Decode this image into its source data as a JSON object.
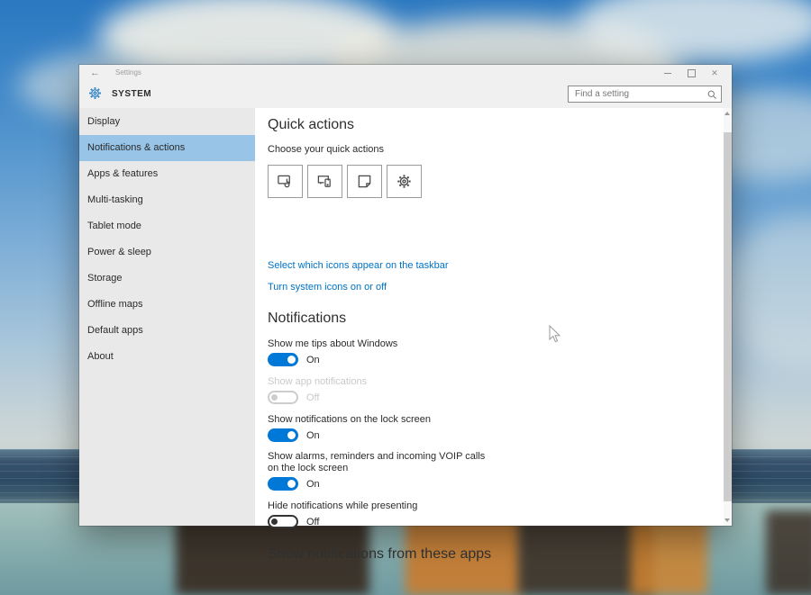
{
  "wallpaper": {
    "sky_top": "#2b78c1",
    "horizon": "#cdd6d4",
    "ocean": "#2c4a64",
    "beach": "#8fb3b2",
    "reflection_dark": "#34251b",
    "reflection_orange": "#ca7b2e"
  },
  "colors": {
    "accent": "#0078d7",
    "link": "#0073c5",
    "sidebar_selected": "#97c4e7"
  },
  "window": {
    "titlebar": {
      "title": "Settings",
      "back_icon": "←",
      "minimize_icon": "–",
      "maximize_icon": "□",
      "close_icon": "✕"
    },
    "header": {
      "app_title": "SYSTEM",
      "gear_icon": "gear",
      "search_placeholder": "Find a setting",
      "search_icon": "magnifier"
    },
    "sidebar": {
      "items": [
        {
          "label": "Display",
          "selected": false
        },
        {
          "label": "Notifications & actions",
          "selected": true
        },
        {
          "label": "Apps & features",
          "selected": false
        },
        {
          "label": "Multi-tasking",
          "selected": false
        },
        {
          "label": "Tablet mode",
          "selected": false
        },
        {
          "label": "Power & sleep",
          "selected": false
        },
        {
          "label": "Storage",
          "selected": false
        },
        {
          "label": "Offline maps",
          "selected": false
        },
        {
          "label": "Default apps",
          "selected": false
        },
        {
          "label": "About",
          "selected": false
        }
      ]
    },
    "content": {
      "quick_actions": {
        "heading": "Quick actions",
        "subheading": "Choose your quick actions",
        "buttons": [
          {
            "icon": "tablet-mode-icon"
          },
          {
            "icon": "connect-icon"
          },
          {
            "icon": "note-icon"
          },
          {
            "icon": "all-settings-icon"
          }
        ],
        "link_taskbar_icons": "Select which icons appear on the taskbar",
        "link_system_icons": "Turn system icons on or off"
      },
      "notifications": {
        "heading": "Notifications",
        "toggles": [
          {
            "label": "Show me tips about Windows",
            "state": "On",
            "enabled": true
          },
          {
            "label": "Show app notifications",
            "state": "Off",
            "enabled": false
          },
          {
            "label": "Show notifications on the lock screen",
            "state": "On",
            "enabled": true
          },
          {
            "label": "Show alarms, reminders and incoming VOIP calls on the lock screen",
            "state": "On",
            "enabled": true
          },
          {
            "label": "Hide notifications while presenting",
            "state": "Off",
            "enabled": true
          }
        ]
      },
      "apps_section_heading": "Show notifications from these apps"
    }
  }
}
